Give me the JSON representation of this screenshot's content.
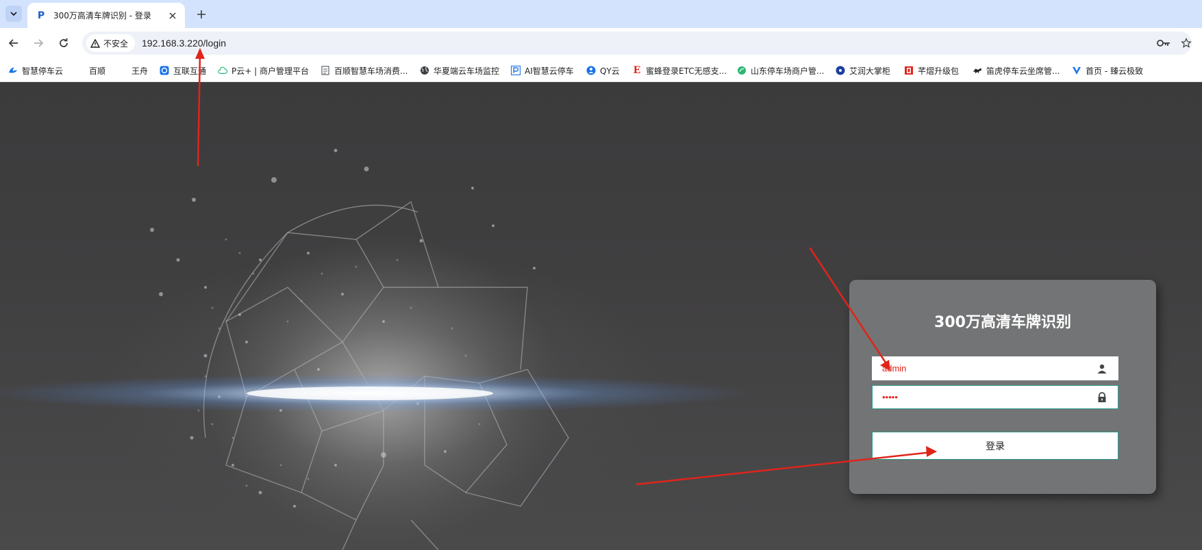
{
  "browser": {
    "tab": {
      "favicon": "P",
      "title": "300万高清车牌识别 - 登录"
    },
    "omnibox": {
      "security_label": "不安全",
      "url": "192.168.3.220/login"
    }
  },
  "bookmarks": [
    {
      "label": "智慧停车云",
      "icon": "cloud-logo-icon",
      "color": "#1a73e8"
    },
    {
      "label": "百顺",
      "icon": "blank-icon",
      "color": "#ffffff"
    },
    {
      "label": "王舟",
      "icon": "blank-icon",
      "color": "#ffffff"
    },
    {
      "label": "互联互通",
      "icon": "circle-logo-icon",
      "color": "#1a73e8"
    },
    {
      "label": "P云+ | 商户管理平台",
      "icon": "cloud-outline-icon",
      "color": "#2bb673"
    },
    {
      "label": "百顺智慧车场消费...",
      "icon": "document-icon",
      "color": "#5f6368"
    },
    {
      "label": "华夏端云车场监控",
      "icon": "globe-icon",
      "color": "#3c4043"
    },
    {
      "label": "AI智慧云停车",
      "icon": "parking-icon",
      "color": "#1a73e8"
    },
    {
      "label": "QY云",
      "icon": "user-circle-icon",
      "color": "#1a73e8"
    },
    {
      "label": "蜜蜂登录ETC无感支...",
      "icon": "letter-e-icon",
      "color": "#e0241b"
    },
    {
      "label": "山东停车场商户管...",
      "icon": "leaf-icon",
      "color": "#2bb673"
    },
    {
      "label": "艾润大掌柜",
      "icon": "blue-dot-icon",
      "color": "#1a73e8"
    },
    {
      "label": "芊熠升级包",
      "icon": "red-square-icon",
      "color": "#e0241b"
    },
    {
      "label": "笛虎停车云坐席管...",
      "icon": "tiger-icon",
      "color": "#202124"
    },
    {
      "label": "首页 - 臻云极致",
      "icon": "v-logo-icon",
      "color": "#1a73e8"
    }
  ],
  "login": {
    "title": "300万高清车牌识别",
    "username_value": "admin",
    "password_value": "•••••",
    "submit_label": "登录"
  },
  "colors": {
    "annotation_arrow": "#e0241b",
    "input_text": "#e0241b",
    "input_border_focus": "#2a9a8a",
    "card_bg": "#737475"
  }
}
